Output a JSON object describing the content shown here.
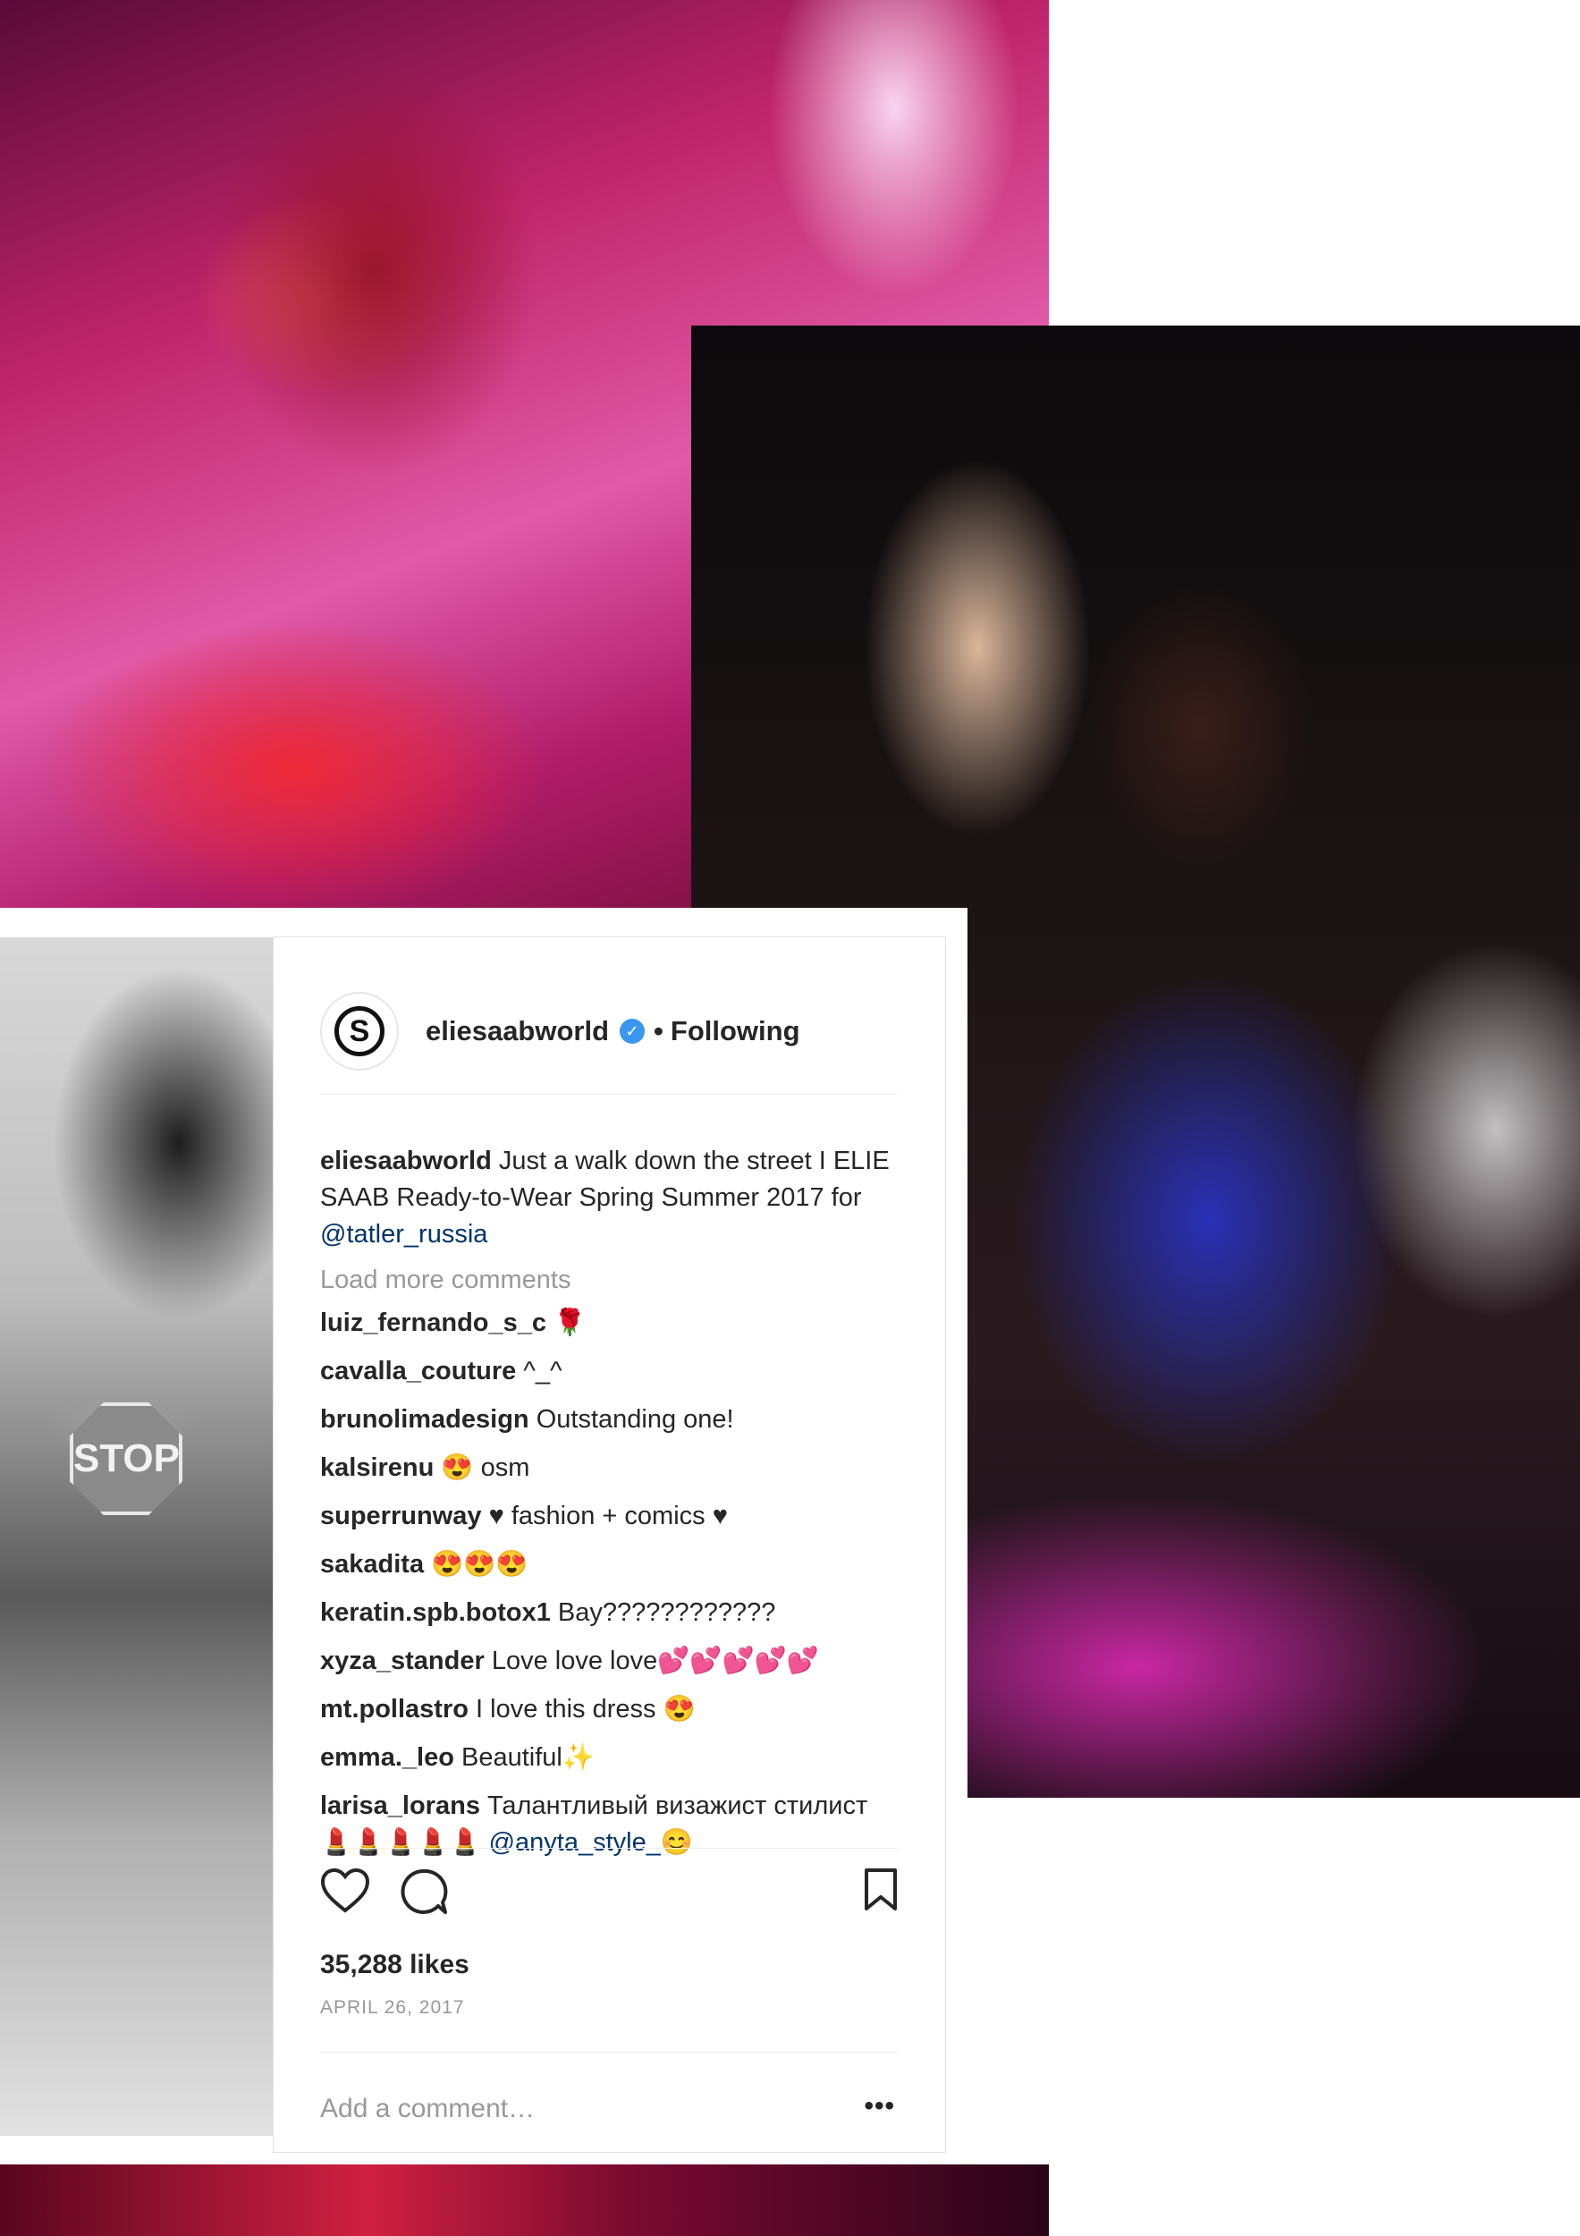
{
  "post": {
    "username": "eliesaabworld",
    "verified_glyph": "✓",
    "separator": "•",
    "follow_status": "Following",
    "avatar_letter": "S",
    "caption": {
      "username": "eliesaabworld",
      "text": "Just a walk down the street I ELIE SAAB Ready-to-Wear Spring Summer 2017 for",
      "mention": "@tatler_russia"
    },
    "load_more": "Load more comments",
    "comments": [
      {
        "user": "luiz_fernando_s_c",
        "text": "🌹"
      },
      {
        "user": "cavalla_couture",
        "text": "^_^"
      },
      {
        "user": "brunolimadesign",
        "text": "Outstanding one!"
      },
      {
        "user": "kalsirenu",
        "text": "😍 osm"
      },
      {
        "user": "superrunway",
        "text": "♥ fashion + comics ♥"
      },
      {
        "user": "sakadita",
        "text": "😍😍😍"
      },
      {
        "user": "keratin.spb.botox1",
        "text": "Bay????????????"
      },
      {
        "user": "xyza_stander",
        "text": "Love love love💕💕💕💕💕"
      },
      {
        "user": "mt.pollastro",
        "text": "I love this dress 😍"
      },
      {
        "user": "emma._leo",
        "text": "Beautiful✨"
      },
      {
        "user": "larisa_lorans",
        "text": "Талантливый визажист стилист 💄💄💄💄💄",
        "mention": "@anyta_style_😊"
      }
    ],
    "likes": "35,288 likes",
    "date": "APRIL 26, 2017",
    "add_comment_placeholder": "Add a comment…",
    "more_glyph": "•••"
  },
  "photos": {
    "street_sign": "STOP"
  },
  "icons": {
    "heart": "heart-icon",
    "comment": "comment-icon",
    "bookmark": "bookmark-icon",
    "more": "more-options-icon",
    "verified": "verified-badge-icon"
  },
  "colors": {
    "verified_blue": "#3897f0",
    "mention": "#003569",
    "text": "#262626",
    "muted": "#999999"
  }
}
